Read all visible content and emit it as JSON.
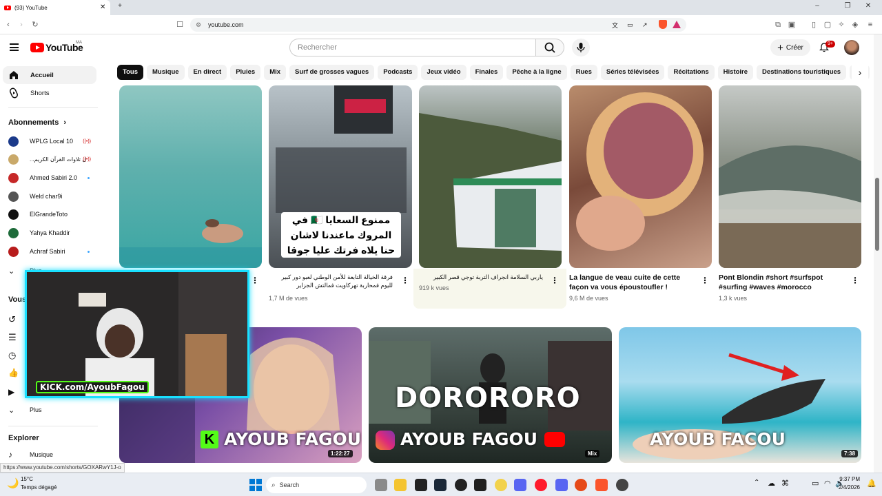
{
  "browser": {
    "tab_title": "(93) YouTube",
    "url": "youtube.com",
    "status_url": "https://www.youtube.com/shorts/GOXARwY1J-o"
  },
  "header": {
    "logo_text": "YouTube",
    "country_code": "MA",
    "search_placeholder": "Rechercher",
    "create_label": "Créer",
    "notif_count": "9+"
  },
  "chips": [
    "Tous",
    "Musique",
    "En direct",
    "Pluies",
    "Mix",
    "Surf de grosses vagues",
    "Podcasts",
    "Jeux vidéo",
    "Finales",
    "Pêche à la ligne",
    "Rues",
    "Séries télévisées",
    "Récitations",
    "Histoire",
    "Destinations touristiques",
    "Co"
  ],
  "sidebar": {
    "home": "Accueil",
    "shorts": "Shorts",
    "subs_title": "Abonnements",
    "subs": [
      {
        "name": "WPLG Local 10",
        "status": "live",
        "color": "#1b3a8a"
      },
      {
        "name": "...ل تلاوات القرآن الكريم",
        "status": "live",
        "color": "#c9a96a"
      },
      {
        "name": "Ahmed Sabiri 2.0",
        "status": "dot",
        "color": "#c62828"
      },
      {
        "name": "Weld char9i",
        "status": "",
        "color": "#555555"
      },
      {
        "name": "ElGrandeToto",
        "status": "",
        "color": "#111111"
      },
      {
        "name": "Yahya Khaddir",
        "status": "",
        "color": "#1e6b3a"
      },
      {
        "name": "Achraf Sabiri",
        "status": "dot",
        "color": "#b71c1c"
      }
    ],
    "more_subs": "Plus",
    "you_title": "Vous",
    "more": "Plus",
    "explore_title": "Explorer",
    "music": "Musique"
  },
  "shorts": [
    {
      "title": "",
      "views": ""
    },
    {
      "title": "فرقة الخيالة التابعة للأمن الوطني لعبو دور كبير لليوم فمحاربة تهركاويت فمالتش الجزاير",
      "views": "1,7 M de vues",
      "overlay": "ممنوع السعايا 🇩🇿 في المروك ماعندنا لاشان حنا يلاه فرتك عليا جوقا"
    },
    {
      "title": "ياربي السلامة   انجراف التربة توجي قصر الكبير",
      "views": "919 k vues"
    },
    {
      "title": "La langue de veau cuite de cette façon va vous époustoufler !",
      "views": "9,6 M de vues"
    },
    {
      "title": "Pont Blondin #short #surfspot #surfing #waves #morocco",
      "views": "1,3 k vues"
    }
  ],
  "videos": [
    {
      "overlay": "AYOUB FAGOU",
      "duration": "1:22:27"
    },
    {
      "overlay_top": "DORORORO",
      "overlay": "AYOUB FAGOU",
      "duration": "Mix"
    },
    {
      "overlay": "AYOUB FACOU",
      "duration": "7:38"
    }
  ],
  "webcam": {
    "kick_label": "KICK.com/AyoubFagou"
  },
  "taskbar": {
    "search": "Search",
    "temp": "15°C",
    "weather": "Temps dégagé",
    "time": "9:37 PM",
    "date": "2/4/2026"
  },
  "colors": {
    "accent": "#ff0000",
    "webcam_border": "#19e0ff",
    "kick_green": "#53fc18"
  }
}
